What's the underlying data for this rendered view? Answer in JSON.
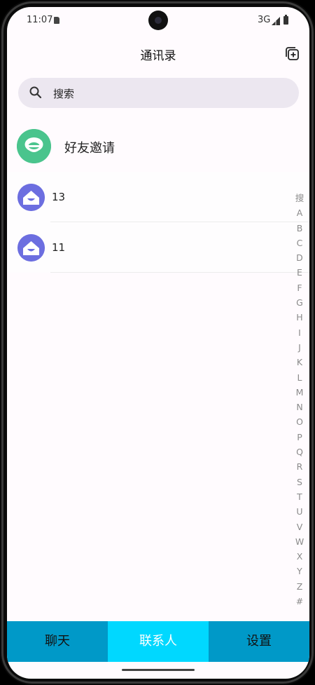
{
  "status": {
    "time": "11:07",
    "network": "3G"
  },
  "header": {
    "title": "通讯录",
    "add_icon": "add-contact-icon"
  },
  "search": {
    "placeholder": "搜索",
    "icon": "search-icon"
  },
  "invite": {
    "label": "好友邀请",
    "color": "#4ac48d"
  },
  "contacts": [
    {
      "name": "13"
    },
    {
      "name": "11"
    }
  ],
  "index_letters": [
    "搜",
    "A",
    "B",
    "C",
    "D",
    "E",
    "F",
    "G",
    "H",
    "I",
    "J",
    "K",
    "L",
    "M",
    "N",
    "O",
    "P",
    "Q",
    "R",
    "S",
    "T",
    "U",
    "V",
    "W",
    "X",
    "Y",
    "Z",
    "#"
  ],
  "bottom_nav": [
    {
      "label": "聊天",
      "active": false
    },
    {
      "label": "联系人",
      "active": true
    },
    {
      "label": "设置",
      "active": false
    }
  ],
  "colors": {
    "nav_bg": "#0099c8",
    "nav_active_bg": "#00d8ff",
    "contact_avatar": "#6c6ee0",
    "search_bg": "#ece7f0"
  }
}
